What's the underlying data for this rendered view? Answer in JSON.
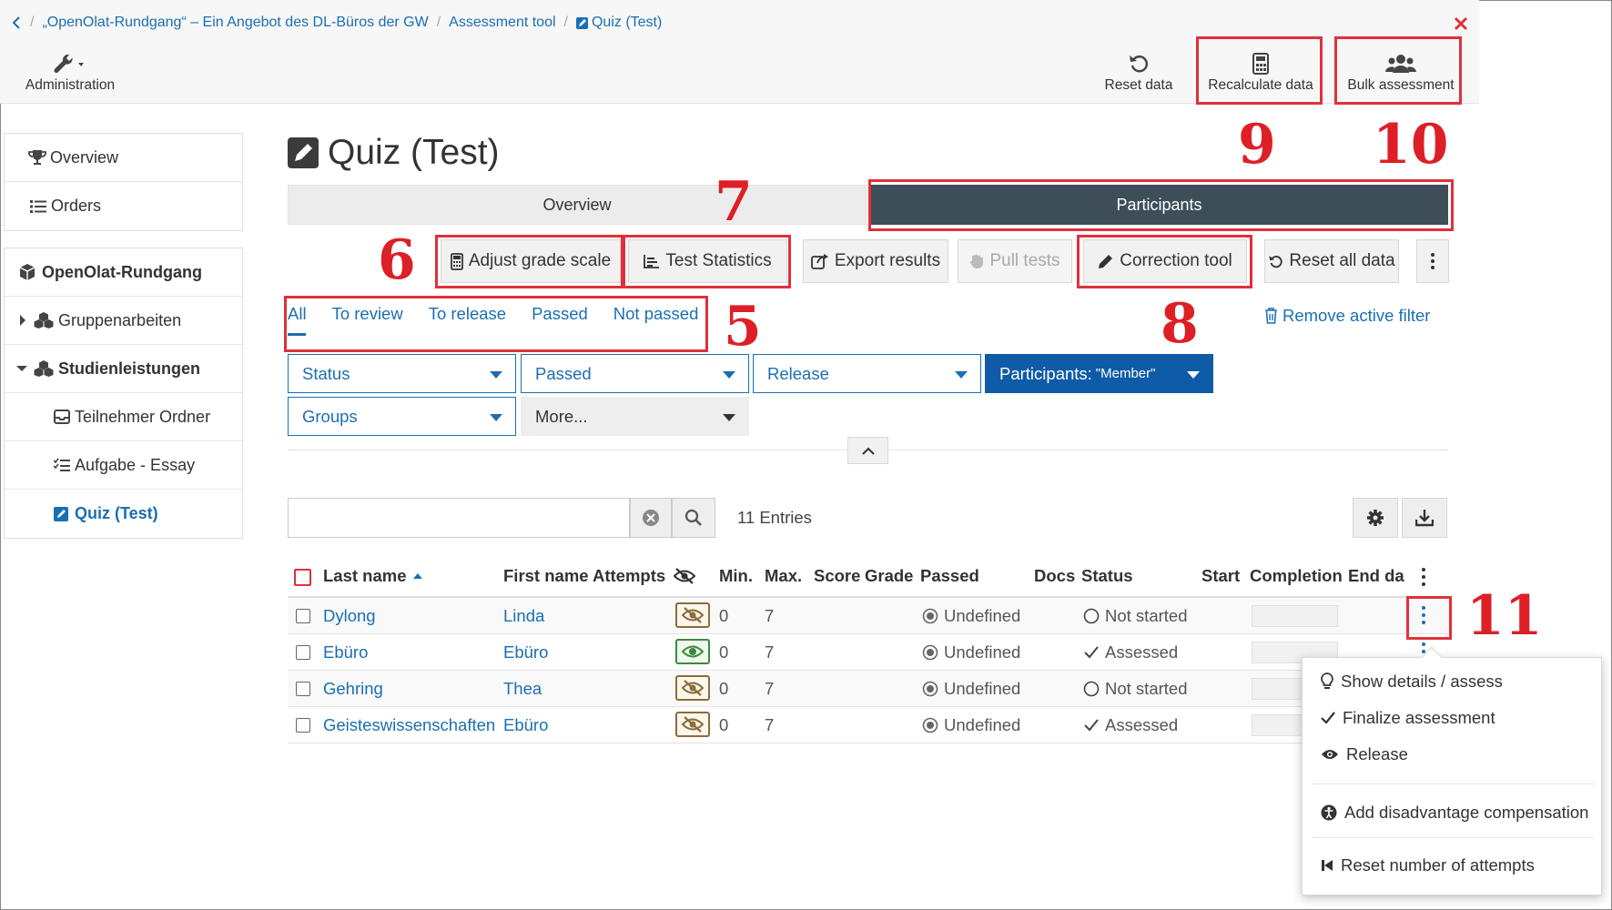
{
  "breadcrumb": {
    "course": "„OpenOlat-Rundgang“ – Ein Angebot des DL-Büros der GW",
    "tool": "Assessment tool",
    "current": "Quiz (Test)"
  },
  "toolbar": {
    "administration": "Administration",
    "reset_data": "Reset data",
    "recalculate_data": "Recalculate data",
    "bulk_assessment": "Bulk assessment"
  },
  "sidebar": {
    "top": [
      "Overview",
      "Orders"
    ],
    "course_title": "OpenOlat-Rundgang",
    "nodes": {
      "group_work": "Gruppenarbeiten",
      "study_achievements": "Studienleistungen",
      "participant_folder": "Teilnehmer Ordner",
      "essay_task": "Aufgabe - Essay",
      "quiz": "Quiz (Test)"
    }
  },
  "main": {
    "title": "Quiz (Test)",
    "segments": [
      "Overview",
      "Participants"
    ],
    "buttons": {
      "adjust_grade_scale": "Adjust grade scale",
      "test_statistics": "Test Statistics",
      "export_results": "Export results",
      "pull_tests": "Pull tests",
      "correction_tool": "Correction tool",
      "reset_all_data": "Reset all data"
    },
    "filter_tabs": [
      "All",
      "To review",
      "To release",
      "Passed",
      "Not passed"
    ],
    "remove_filter": "Remove active filter",
    "filters": {
      "status": "Status",
      "passed": "Passed",
      "release": "Release",
      "participants": "Participants: ",
      "participants_value": "\"Member\"",
      "groups": "Groups",
      "more": "More..."
    },
    "entries": "11 Entries",
    "columns": [
      "Last name",
      "First name",
      "Attempts",
      "Min.",
      "Max.",
      "Score",
      "Grade",
      "Passed",
      "Docs",
      "Status",
      "Start",
      "Completion",
      "End dat"
    ],
    "rows": [
      {
        "last": "Dylong",
        "first": "Linda",
        "min": "0",
        "max": "7",
        "passed": "Undefined",
        "status": "Not started",
        "visible": false
      },
      {
        "last": "Ebüro",
        "first": "Ebüro",
        "min": "0",
        "max": "7",
        "passed": "Undefined",
        "status": "Assessed",
        "visible": true
      },
      {
        "last": "Gehring",
        "first": "Thea",
        "min": "0",
        "max": "7",
        "passed": "Undefined",
        "status": "Not started",
        "visible": false
      },
      {
        "last": "Geisteswissenschaften",
        "first": "Ebüro",
        "min": "0",
        "max": "7",
        "passed": "Undefined",
        "status": "Assessed",
        "visible": false
      }
    ]
  },
  "context_menu": {
    "show_details": "Show details / assess",
    "finalize": "Finalize assessment",
    "release": "Release",
    "compensation": "Add disadvantage compensation",
    "reset_attempts": "Reset number of attempts"
  },
  "annotations": {
    "n5": "5",
    "n6": "6",
    "n7": "7",
    "n8": "8",
    "n9": "9",
    "n10": "10",
    "n11": "11"
  },
  "colors": {
    "accent": "#1a6fb3",
    "dark_segment": "#3d4e59",
    "annotation_red": "#e0303b",
    "filter_active": "#0f5ba7"
  }
}
